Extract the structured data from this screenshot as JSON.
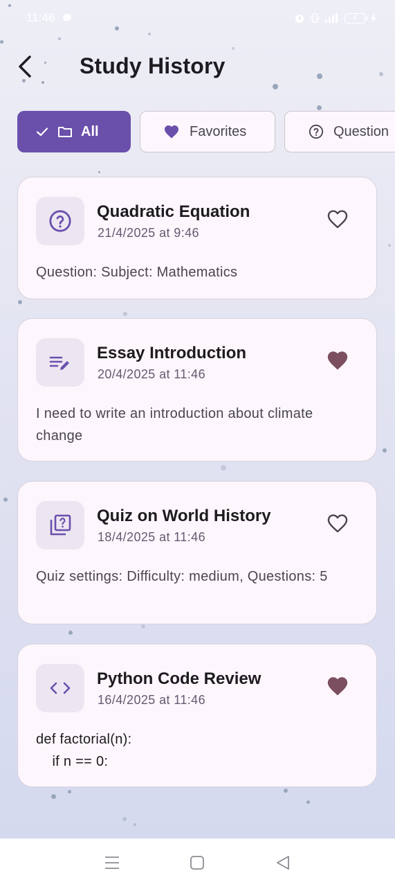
{
  "status_bar": {
    "time": "11:46",
    "battery_level": "4",
    "icons": [
      "chat-bubble-icon",
      "alarm-icon",
      "vibrate-icon",
      "signal-icon",
      "battery-icon",
      "charging-icon"
    ]
  },
  "header": {
    "title": "Study History",
    "back_icon": "chevron-left-icon"
  },
  "filters": [
    {
      "label": "All",
      "selected": true,
      "icons": [
        "check-icon",
        "folder-icon"
      ]
    },
    {
      "label": "Favorites",
      "selected": false,
      "icon": "heart-icon"
    },
    {
      "label": "Question",
      "selected": false,
      "icon": "question-circle-icon"
    }
  ],
  "history": [
    {
      "title": "Quadratic Equation",
      "date": "21/4/2025 at 9:46",
      "body": "Question: Subject: Mathematics",
      "icon": "question-circle-icon",
      "favorite": false
    },
    {
      "title": "Essay Introduction",
      "date": "20/4/2025 at 11:46",
      "body": "I need to write an introduction about climate change",
      "icon": "edit-note-icon",
      "favorite": true
    },
    {
      "title": "Quiz on World History",
      "date": "18/4/2025 at 11:46",
      "body": "Quiz settings: Difficulty: medium, Questions: 5",
      "icon": "quiz-icon",
      "favorite": false
    },
    {
      "title": "Python Code Review",
      "date": "16/4/2025 at 11:46",
      "body": "def factorial(n):\n    if n == 0:",
      "icon": "code-icon",
      "favorite": true
    }
  ],
  "colors": {
    "accent": "#6a4fab",
    "favorite": "#7b4f5f",
    "card_background": "#fdf6fc",
    "icon_tile": "#ece6f2"
  },
  "nav_bar": {
    "buttons": [
      "menu-icon",
      "home-square-icon",
      "back-triangle-icon"
    ]
  }
}
